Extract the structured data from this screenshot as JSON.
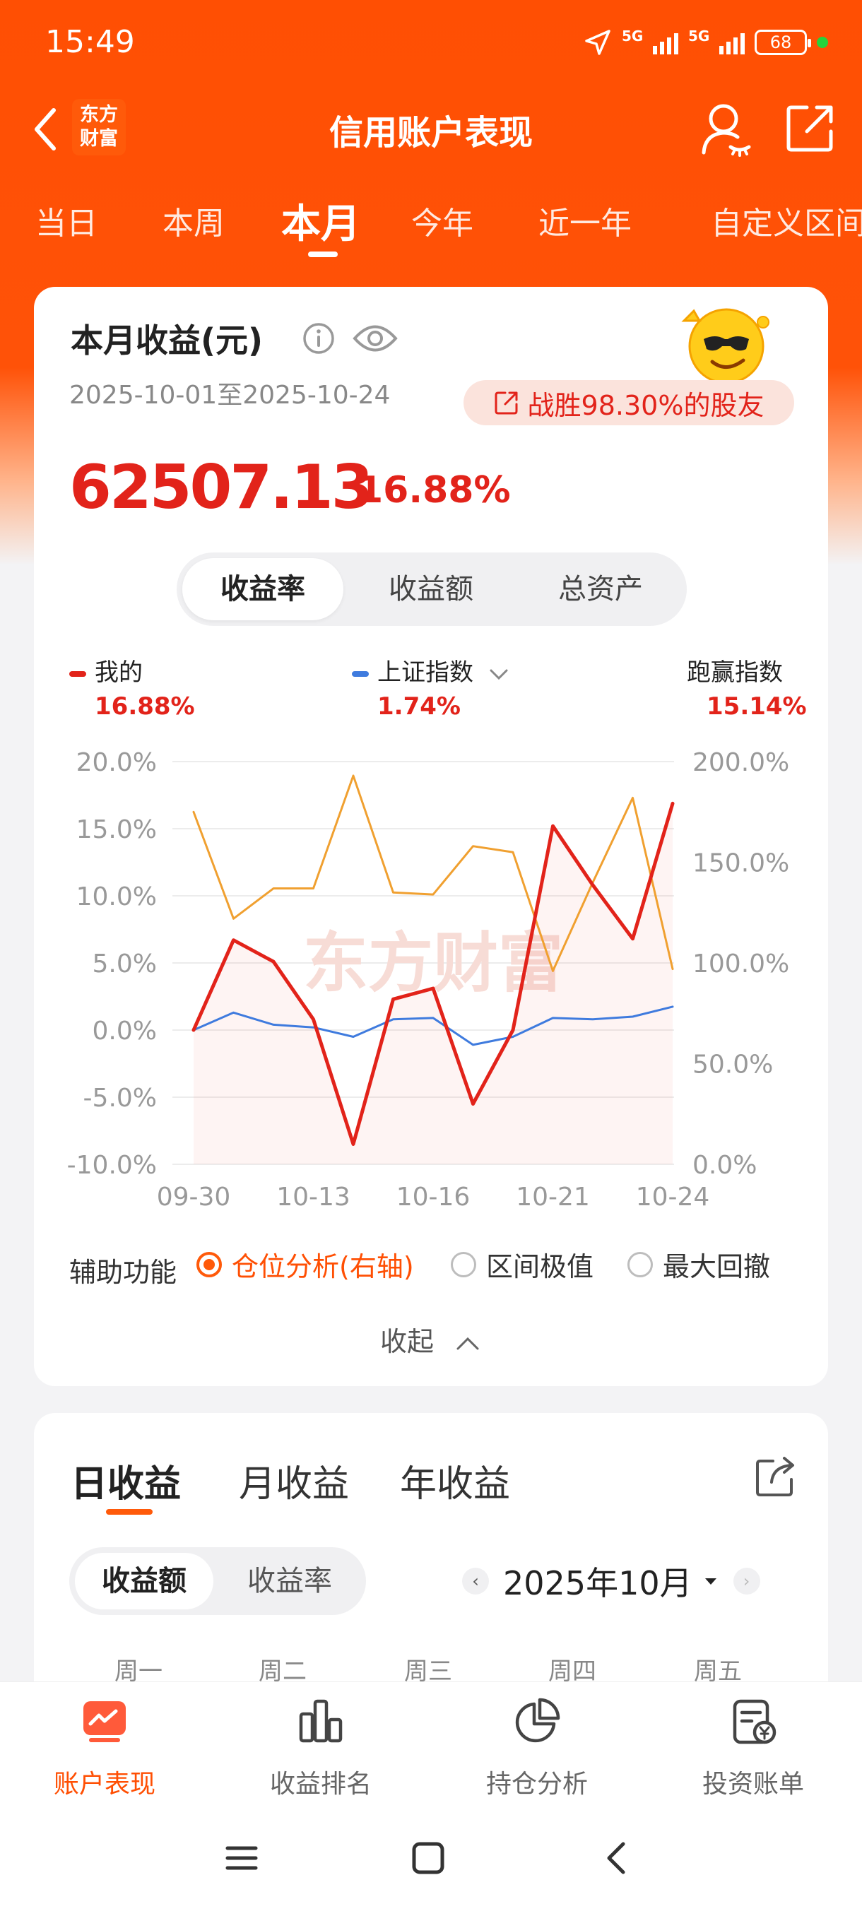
{
  "status_bar": {
    "time": "15:49",
    "net1": "5G",
    "net2": "5G",
    "battery": "68"
  },
  "header": {
    "title": "信用账户表现",
    "logo_line1": "东方",
    "logo_line2": "财富"
  },
  "tabs": [
    {
      "label": "当日"
    },
    {
      "label": "本周"
    },
    {
      "label": "本月",
      "active": true
    },
    {
      "label": "今年"
    },
    {
      "label": "近一年"
    },
    {
      "label": "自定义区间"
    }
  ],
  "summary": {
    "title": "本月收益(元)",
    "date_range": "2025-10-01至2025-10-24",
    "beat_text": "战胜98.30%的股友",
    "amount": "62507.13",
    "percent": "16.88%"
  },
  "segment": {
    "options": [
      "收益率",
      "收益额",
      "总资产"
    ],
    "selected": "收益率"
  },
  "legend": {
    "mine": {
      "label": "我的",
      "value": "16.88%",
      "color": "#e2231a"
    },
    "index": {
      "label": "上证指数",
      "value": "1.74%",
      "color": "#3f7bde"
    },
    "outperform": {
      "label": "跑赢指数",
      "value": "15.14%"
    }
  },
  "watermark": "东方财富",
  "chart_data": {
    "type": "line",
    "x": [
      "09-30",
      "10-09",
      "10-10",
      "10-13",
      "10-14",
      "10-15",
      "10-16",
      "10-17",
      "10-20",
      "10-21",
      "10-22",
      "10-23",
      "10-24"
    ],
    "x_tick_labels": [
      "09-30",
      "10-13",
      "10-16",
      "10-21",
      "10-24"
    ],
    "series": [
      {
        "name": "我的",
        "axis": "left",
        "color": "#e2231a",
        "values": [
          0.0,
          6.7,
          5.1,
          0.8,
          -8.5,
          2.3,
          3.1,
          -5.5,
          0.0,
          15.2,
          10.8,
          6.8,
          16.88
        ]
      },
      {
        "name": "上证指数",
        "axis": "left",
        "color": "#3f7bde",
        "values": [
          0.0,
          1.3,
          0.4,
          0.2,
          -0.5,
          0.8,
          0.9,
          -1.1,
          -0.5,
          0.9,
          0.8,
          1.0,
          1.74
        ]
      },
      {
        "name": "仓位分析(右轴)",
        "axis": "right",
        "color": "#f0a030",
        "values": [
          175.0,
          122.0,
          137.0,
          137.0,
          193.0,
          135.0,
          134.0,
          158.0,
          155.0,
          96.0,
          140.0,
          182.0,
          97.0
        ]
      }
    ],
    "y_left": {
      "ticks": [
        "20.0%",
        "15.0%",
        "10.0%",
        "5.0%",
        "0.0%",
        "-5.0%",
        "-10.0%"
      ],
      "range": [
        -10,
        20
      ]
    },
    "y_right": {
      "ticks": [
        "200.0%",
        "150.0%",
        "100.0%",
        "50.0%",
        "0.0%"
      ],
      "range": [
        0,
        200
      ]
    },
    "grid": true
  },
  "aux": {
    "label": "辅助功能",
    "options": [
      {
        "label": "仓位分析(右轴)",
        "checked": true
      },
      {
        "label": "区间极值",
        "checked": false
      },
      {
        "label": "最大回撤",
        "checked": false
      }
    ]
  },
  "collapse_label": "收起",
  "daily": {
    "tabs": [
      "日收益",
      "月收益",
      "年收益"
    ],
    "active_tab": "日收益",
    "segment": [
      "收益额",
      "收益率"
    ],
    "segment_selected": "收益额",
    "month": "2025年10月",
    "weekdays": [
      "周一",
      "周二",
      "周三",
      "周四",
      "周五"
    ]
  },
  "bottom_nav": [
    {
      "label": "账户表现",
      "active": true
    },
    {
      "label": "收益排名"
    },
    {
      "label": "持仓分析"
    },
    {
      "label": "投资账单"
    }
  ]
}
